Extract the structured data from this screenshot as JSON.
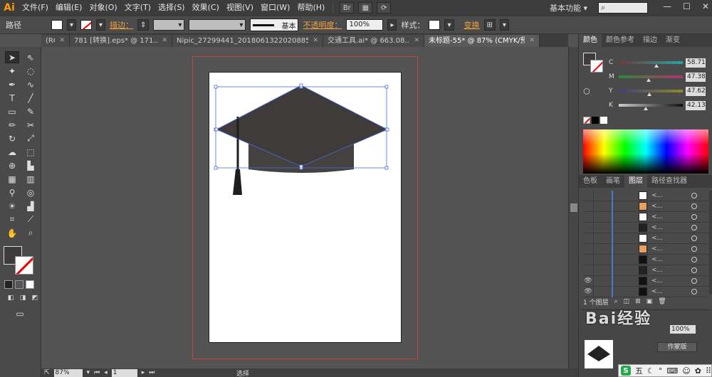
{
  "app": {
    "logo": "Ai"
  },
  "menu": [
    "文件(F)",
    "编辑(E)",
    "对象(O)",
    "文字(T)",
    "选择(S)",
    "效果(C)",
    "视图(V)",
    "窗口(W)",
    "帮助(H)"
  ],
  "menu_extras": {
    "br_label": "Br"
  },
  "workspace": {
    "label": "基本功能",
    "caret": "▾"
  },
  "window_controls": {
    "minimize": "—",
    "maximize": "☐",
    "close": "✕"
  },
  "control": {
    "object_type": "路径",
    "stroke_label": "描边：",
    "stroke_style": "基本",
    "opacity_label": "不透明度：",
    "opacity_value": "100%",
    "style_label": "样式：",
    "transform_label": "变换"
  },
  "tabs": [
    {
      "label": "(RG...",
      "active": false
    },
    {
      "label": "781 [转换].eps* @ 171...",
      "active": false
    },
    {
      "label": "Nipic_27299441_20180613220208854088.ai*",
      "active": false
    },
    {
      "label": "交通工具.ai* @ 663.08...",
      "active": false
    },
    {
      "label": "未标题-55* @ 87% (CMYK/预览)",
      "active": true
    }
  ],
  "status": {
    "zoom": "87%",
    "page": "1",
    "tool": "选择"
  },
  "color_panel": {
    "tabs": [
      "颜色",
      "颜色参考",
      "描边",
      "渐变"
    ],
    "active_tab": "颜色",
    "channels": [
      {
        "name": "C",
        "value": "58.71",
        "pos": 0.59,
        "gradient": "linear-gradient(to right,#6b3a3a,#2aa2a2)"
      },
      {
        "name": "M",
        "value": "47.38",
        "pos": 0.47,
        "gradient": "linear-gradient(to right,#2e8a3a,#b0306a)"
      },
      {
        "name": "Y",
        "value": "47.62",
        "pos": 0.48,
        "gradient": "linear-gradient(to right,#4a3a7a,#8a8a30)"
      },
      {
        "name": "K",
        "value": "42.13",
        "pos": 0.42,
        "gradient": "linear-gradient(to right,#cccccc,#111111)"
      }
    ]
  },
  "layers_panel": {
    "tabs": [
      "色板",
      "画笔",
      "图层",
      "路径查找器"
    ],
    "active_tab": "图层",
    "rows": [
      {
        "name": "<...",
        "eye": false,
        "thumb": "#ffffff"
      },
      {
        "name": "<...",
        "eye": false,
        "thumb": "#e8a060"
      },
      {
        "name": "<...",
        "eye": false,
        "thumb": "#ffffff"
      },
      {
        "name": "<...",
        "eye": false,
        "thumb": "#222222"
      },
      {
        "name": "<...",
        "eye": false,
        "thumb": "#ffffff"
      },
      {
        "name": "<...",
        "eye": false,
        "thumb": "#e8a060"
      },
      {
        "name": "<...",
        "eye": false,
        "thumb": "#111111"
      },
      {
        "name": "<...",
        "eye": false,
        "thumb": "#222222"
      },
      {
        "name": "<...",
        "eye": true,
        "thumb": "#111111"
      },
      {
        "name": "<...",
        "eye": true,
        "thumb": "#111111"
      }
    ],
    "footer_label": "1 个图层"
  },
  "bottom_panel": {
    "opacity_value": "100%",
    "button_label": "作蒙版"
  },
  "ime": {
    "logo": "S",
    "mode": "五"
  },
  "watermark": "Bai经验",
  "artwork": {
    "cap_color": "#3f3b3b",
    "base_color": "#454141",
    "band_color": "#4a4646",
    "tassel_color": "#1e1e1e",
    "selection_color": "#4a6fd8"
  }
}
